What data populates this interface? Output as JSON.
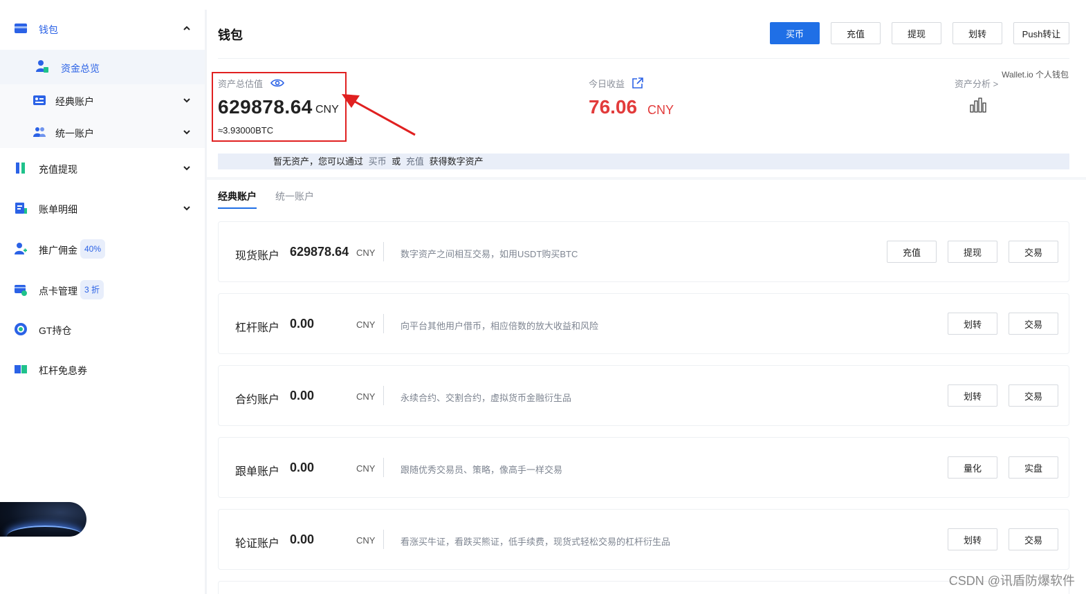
{
  "sidebar": {
    "wallet": "钱包",
    "funds_overview": "资金总览",
    "classic_account": "经典账户",
    "unified_account": "统一账户",
    "deposit_withdraw": "充值提现",
    "bill_details": "账单明细",
    "referral": "推广佣金",
    "referral_badge": "40%",
    "point_card": "点卡管理",
    "point_card_badge": "3 折",
    "gt_holding": "GT持仓",
    "leverage_coupon": "杠杆免息券"
  },
  "header": {
    "title": "钱包",
    "buttons": {
      "buy": "买币",
      "deposit": "充值",
      "withdraw": "提现",
      "transfer": "划转",
      "push": "Push转让"
    }
  },
  "summary": {
    "total_label": "资产总估值",
    "total_value": "629878.64",
    "total_unit": "CNY",
    "btc_value": "≈3.93000BTC",
    "today_label": "今日收益",
    "today_value": "76.06",
    "today_unit": "CNY",
    "wallet_link": "Wallet.io 个人钱包",
    "analysis_link": "资产分析 >"
  },
  "notice": {
    "text1": "暂无资产，您可以通过",
    "link1": "买币",
    "text2": "或",
    "link2": "充值",
    "text3": "获得数字资产"
  },
  "tabs": {
    "classic": "经典账户",
    "unified": "统一账户"
  },
  "accounts": [
    {
      "name": "现货账户",
      "amount": "629878.64",
      "unit": "CNY",
      "desc": "数字资产之间相互交易，如用USDT购买BTC",
      "buttons": [
        "充值",
        "提现",
        "交易"
      ]
    },
    {
      "name": "杠杆账户",
      "amount": "0.00",
      "unit": "CNY",
      "desc": "向平台其他用户借币，相应倍数的放大收益和风险",
      "buttons": [
        "划转",
        "交易"
      ]
    },
    {
      "name": "合约账户",
      "amount": "0.00",
      "unit": "CNY",
      "desc": "永续合约、交割合约，虚拟货币金融衍生品",
      "buttons": [
        "划转",
        "交易"
      ]
    },
    {
      "name": "跟单账户",
      "amount": "0.00",
      "unit": "CNY",
      "desc": "跟随优秀交易员、策略，像高手一样交易",
      "buttons": [
        "量化",
        "实盘"
      ]
    },
    {
      "name": "轮证账户",
      "amount": "0.00",
      "unit": "CNY",
      "desc": "看涨买牛证，看跌买熊证，低手续费，现货式轻松交易的杠杆衍生品",
      "buttons": [
        "划转",
        "交易"
      ]
    }
  ],
  "watermark": "CSDN @讯盾防爆软件",
  "colors": {
    "accent": "#1f6fe6",
    "profit": "#e23b3b",
    "highlight": "#e02020"
  }
}
